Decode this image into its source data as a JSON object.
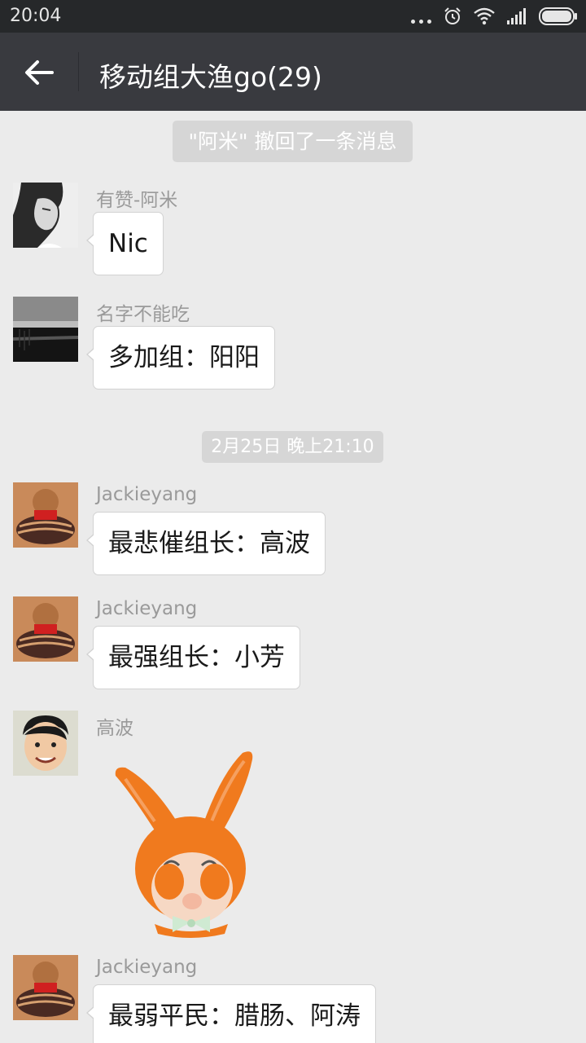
{
  "status_bar": {
    "time": "20:04",
    "icons": [
      "more-dots-icon",
      "alarm-icon",
      "wifi-icon",
      "signal-icon",
      "battery-icon"
    ]
  },
  "header": {
    "back_icon": "back-arrow-icon",
    "title": "移动组大渔go(29)"
  },
  "chat": {
    "recall_notice": "\"阿米\" 撤回了一条消息",
    "timestamp": "2月25日 晚上21:10",
    "messages": [
      {
        "sender": "有赞-阿米",
        "text": "Nic"
      },
      {
        "sender": "名字不能吃",
        "text": "多加组：阳阳"
      },
      {
        "sender": "Jackieyang",
        "text": "最悲催组长：高波"
      },
      {
        "sender": "Jackieyang",
        "text": "最强组长：小芳"
      },
      {
        "sender": "高波",
        "sticker": "bunny-hat-cover-eyes-sticker"
      },
      {
        "sender": "Jackieyang",
        "text": "最弱平民：腊肠、阿涛"
      }
    ]
  },
  "colors": {
    "header_bg": "#393a3f",
    "status_bg": "#26282a",
    "chat_bg": "#ebebeb",
    "sticker_orange": "#f07a1e"
  }
}
